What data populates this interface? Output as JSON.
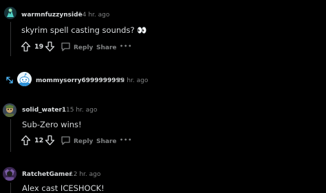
{
  "comments": [
    {
      "username": "warmnfuzzynside",
      "time": "14 hr. ago",
      "text": "skyrim spell casting sounds? 👀",
      "votes": "19",
      "reply_label": "Reply",
      "share_label": "Share",
      "more_label": "•••"
    },
    {
      "username": "mommysorry6999999999",
      "time": "22 hr. ago",
      "collapsed": true
    },
    {
      "username": "solid_water1",
      "time": "15 hr. ago",
      "text": "Sub-Zero wins!",
      "votes": "12",
      "reply_label": "Reply",
      "share_label": "Share",
      "more_label": "•••"
    },
    {
      "username": "RatchetGamer",
      "time": "12 hr. ago",
      "text": "Alex cast ICESHOCK!"
    }
  ],
  "separator": "·",
  "colors": {
    "background": "#000000",
    "text": "#d7dadc",
    "muted": "#818384",
    "thread_line": "#343536",
    "expand_icon": "#4fbcff"
  },
  "icons": [
    "upvote-icon",
    "downvote-icon",
    "comment-icon",
    "expand-icon",
    "more-icon"
  ]
}
